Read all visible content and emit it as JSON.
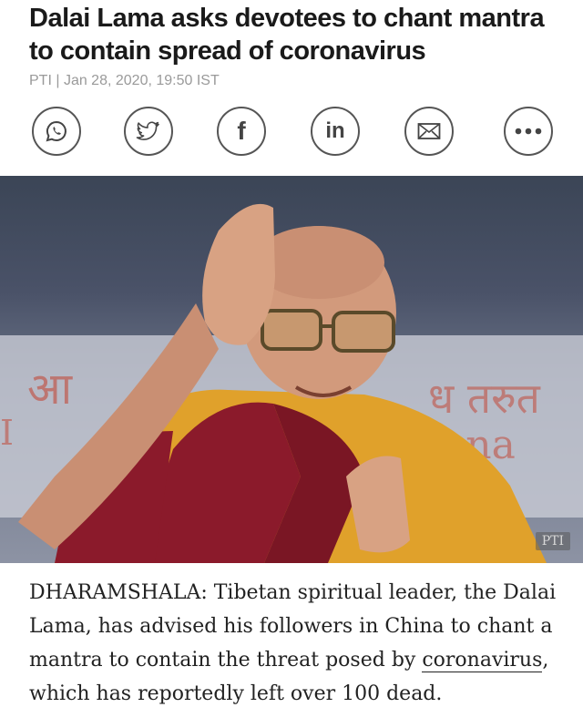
{
  "article": {
    "headline": "Dalai Lama asks devotees to chant mantra to contain spread of coronavirus",
    "byline": "PTI | Jan 28, 2020, 19:50 IST",
    "photo_credit": "PTI",
    "body_part1": "DHARAMSHALA: Tibetan spiritual leader, the Dalai Lama, has advised his followers in China to chant a mantra to contain the threat posed by ",
    "body_link": "coronavirus",
    "body_part2": ", which has reportedly left over 100 dead."
  },
  "share": {
    "icons": [
      "whatsapp-icon",
      "twitter-icon",
      "facebook-icon",
      "linkedin-icon",
      "email-icon",
      "more-icon"
    ],
    "facebook_glyph": "f",
    "linkedin_glyph": "in"
  },
  "colors": {
    "headline": "#1a1a1a",
    "byline": "#9a9a9a",
    "icon_stroke": "#555555",
    "robe_red": "#8b1a2b",
    "robe_yellow": "#e0a12b"
  }
}
